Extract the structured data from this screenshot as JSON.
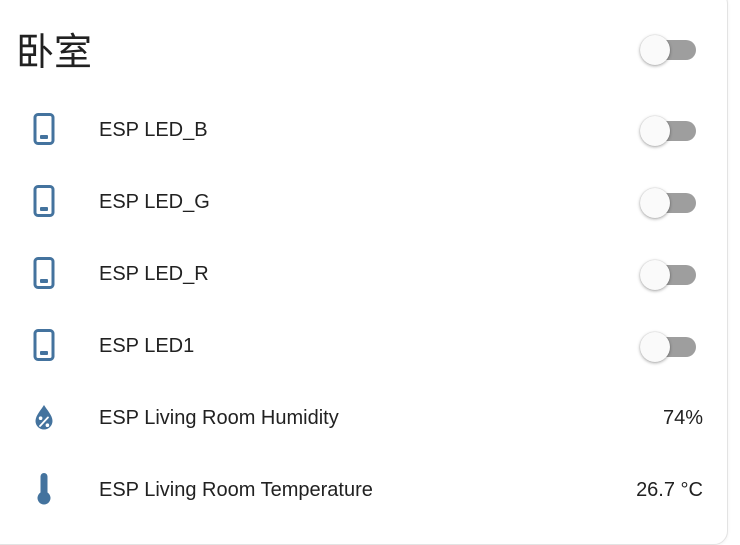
{
  "card": {
    "title": "卧室",
    "accent_color": "#44739e",
    "toggle_off_track": "#9e9e9e",
    "toggle_off_thumb": "#fafafa"
  },
  "entities": [
    {
      "name": "ESP LED_B",
      "icon": "cellphone-icon",
      "state": "off"
    },
    {
      "name": "ESP LED_G",
      "icon": "cellphone-icon",
      "state": "off"
    },
    {
      "name": "ESP LED_R",
      "icon": "cellphone-icon",
      "state": "off"
    },
    {
      "name": "ESP LED1",
      "icon": "cellphone-icon",
      "state": "off"
    },
    {
      "name": "ESP Living Room Humidity",
      "icon": "water-percent-icon",
      "value": "74%"
    },
    {
      "name": "ESP Living Room Temperature",
      "icon": "thermometer-icon",
      "value": "26.7 °C"
    }
  ]
}
